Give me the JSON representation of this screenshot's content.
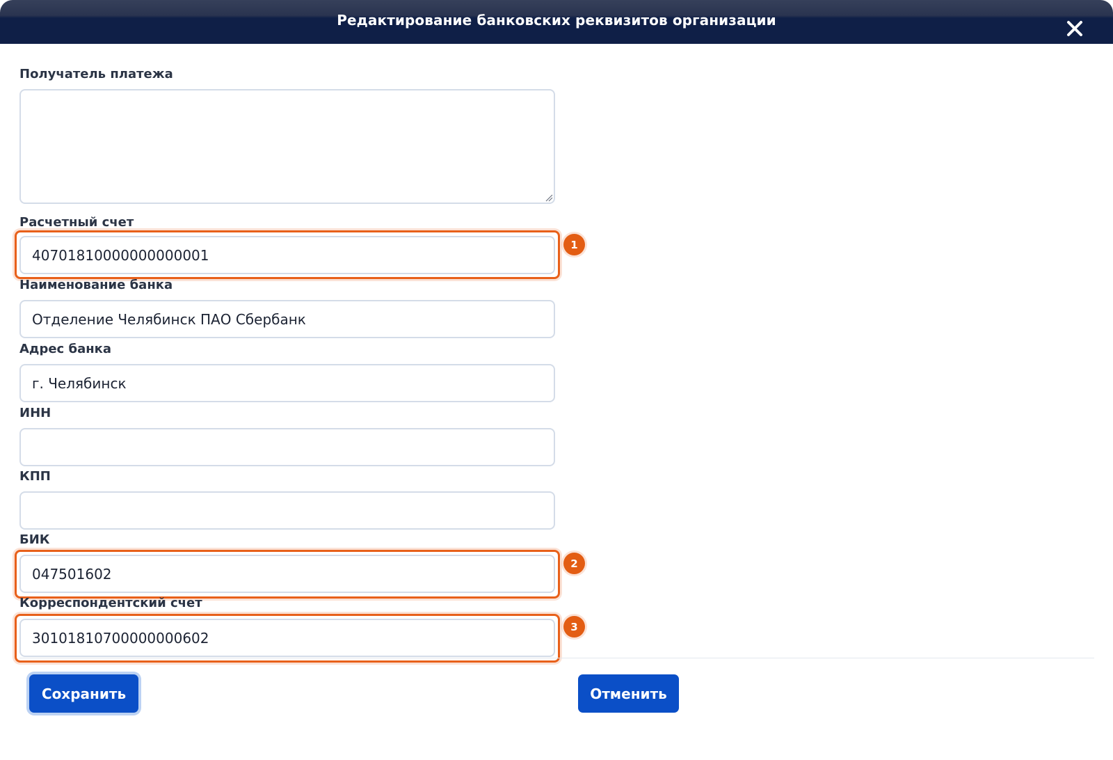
{
  "dialog": {
    "title": "Редактирование банковских реквизитов организации",
    "close_icon": "close-icon"
  },
  "fields": {
    "recipient": {
      "label": "Получатель платежа",
      "value": ""
    },
    "account": {
      "label": "Расчетный счет",
      "value": "40701810000000000001"
    },
    "bank_name": {
      "label": "Наименование банка",
      "value": "Отделение Челябинск ПАО Сбербанк"
    },
    "bank_address": {
      "label": "Адрес банка",
      "value": "г. Челябинск"
    },
    "inn": {
      "label": "ИНН",
      "value": ""
    },
    "kpp": {
      "label": "КПП",
      "value": ""
    },
    "bik": {
      "label": "БИК",
      "value": "047501602"
    },
    "corr_account": {
      "label": "Корреспондентский счет",
      "value": "30101810700000000602"
    }
  },
  "badges": [
    "1",
    "2",
    "3"
  ],
  "buttons": {
    "save": "Сохранить",
    "cancel": "Отменить"
  },
  "colors": {
    "header": "#0f1f47",
    "primary": "#0b4fc7",
    "highlight": "#e8601a"
  }
}
